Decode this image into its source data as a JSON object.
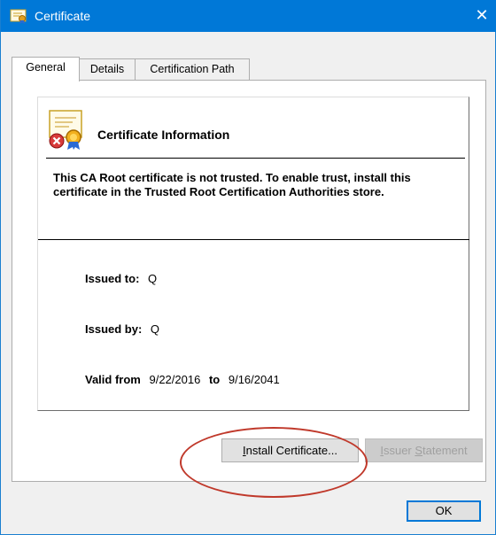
{
  "window": {
    "title": "Certificate",
    "close_glyph": "✕",
    "icon": "certificate-icon"
  },
  "tabs": [
    {
      "label": "General",
      "active": true
    },
    {
      "label": "Details",
      "active": false
    },
    {
      "label": "Certification Path",
      "active": false
    }
  ],
  "info": {
    "icon": "certificate-error-icon",
    "title": "Certificate Information",
    "warning": "This CA Root certificate is not trusted. To enable trust, install this certificate in the Trusted Root Certification Authorities store."
  },
  "fields": {
    "issued_to_label": "Issued to:",
    "issued_to_value": "Q",
    "issued_by_label": "Issued by:",
    "issued_by_value": "Q",
    "valid_from_label": "Valid from",
    "valid_from_value": "9/22/2016",
    "valid_to_label": "to",
    "valid_to_value": "9/16/2041"
  },
  "buttons": {
    "install_prefix": "I",
    "install_rest": "nstall Certificate...",
    "issuer_prefix": "I",
    "issuer_mid": "ssuer ",
    "issuer_s": "S",
    "issuer_rest": "tatement",
    "issuer_disabled": true,
    "ok": "OK"
  },
  "colors": {
    "title_bar": "#0078d7",
    "annotation": "#c0392b"
  }
}
